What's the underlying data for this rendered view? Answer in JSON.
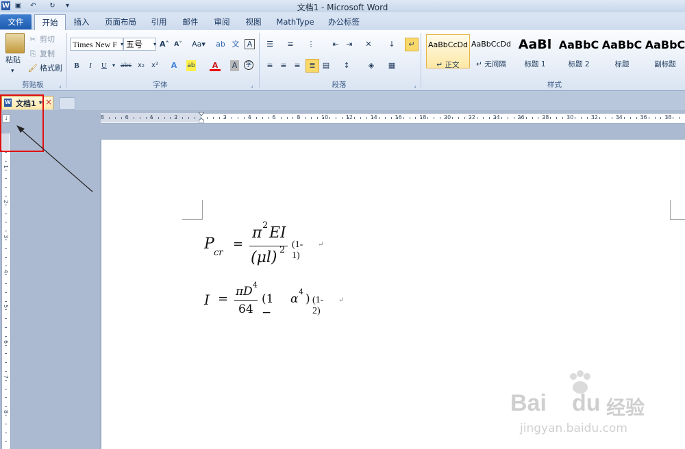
{
  "app_title": "文档1 - Microsoft Word",
  "ribbon_tabs": [
    "文件",
    "开始",
    "插入",
    "页面布局",
    "引用",
    "邮件",
    "审阅",
    "视图",
    "MathType",
    "办公标签"
  ],
  "clipboard": {
    "paste": "粘贴",
    "cut": "剪切",
    "copy": "复制",
    "format_painter": "格式刷",
    "group": "剪贴板"
  },
  "font": {
    "name": "Times New F",
    "size": "五号",
    "group": "字体"
  },
  "paragraph": {
    "group": "段落"
  },
  "styles": {
    "group": "样式",
    "items": [
      {
        "sample": "AaBbCcDd",
        "name": "↵ 正文"
      },
      {
        "sample": "AaBbCcDd",
        "name": "↵ 无间隔"
      },
      {
        "sample": "AaBl",
        "name": "标题 1"
      },
      {
        "sample": "AaBbC",
        "name": "标题 2"
      },
      {
        "sample": "AaBbC",
        "name": "标题"
      },
      {
        "sample": "AaBbC",
        "name": "副标题"
      }
    ]
  },
  "document_tab": {
    "label": "文档1 *",
    "close": "×"
  },
  "ruler_numbers_h": [
    "8",
    "6",
    "4",
    "2",
    "2",
    "4",
    "6",
    "8",
    "10",
    "12",
    "14",
    "16",
    "18",
    "20",
    "22",
    "24",
    "26",
    "28",
    "30",
    "32",
    "34",
    "36",
    "38"
  ],
  "ruler_numbers_v": [
    "1",
    "2",
    "3",
    "4",
    "5",
    "6",
    "7",
    "8",
    "9",
    "10",
    "11",
    "12"
  ],
  "equations": {
    "eq1": {
      "lhs_base": "P",
      "lhs_sub": "cr",
      "equals": "=",
      "num_pi": "π",
      "num_exp": "2",
      "num_rest": "EI",
      "den": "(μl)",
      "den_exp": "2",
      "label": "(1-1)"
    },
    "eq2": {
      "lhs": "I",
      "equals": "=",
      "num_pi": "π",
      "num_D": "D",
      "num_exp": "4",
      "den": "64",
      "paren": "(1 −",
      "alpha": "α",
      "alpha_exp": "4",
      "paren_close": ")",
      "label": "(1-2)"
    }
  },
  "watermark": {
    "brand": "Bai",
    "brand2": "du",
    "cn": "经验",
    "url": "jingyan.baidu.com"
  }
}
